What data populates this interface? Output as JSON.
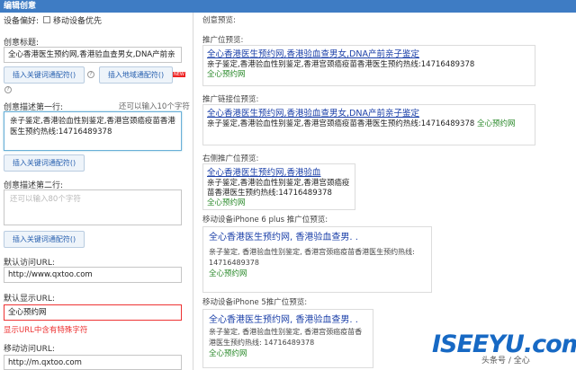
{
  "window": {
    "title": "编辑创意"
  },
  "form": {
    "device_pref_label": "设备偏好:",
    "device_pref_option": "移动设备优先",
    "title_label": "创意标题:",
    "title_value": "全心香港医生预约网,香港验血查男女,DNA产前亲",
    "insert_keyword_btn": "插入关键词通配符()",
    "insert_region_btn": "插入地域通配符()",
    "new_tag": "NEW",
    "desc1_label": "创意描述第一行:",
    "desc1_counter": "还可以输入10个字符",
    "desc1_value": "亲子鉴定,香港验血性别鉴定,香港宫颈癌疫苗香港医生预约热线:14716489378",
    "desc1_btn": "插入关键词通配符()",
    "desc2_label": "创意描述第二行:",
    "desc2_placeholder": "还可以输入80个字符",
    "desc2_btn": "插入关键词通配符()",
    "visit_url_label": "默认访问URL:",
    "visit_url_value": "http://www.qxtoo.com",
    "display_url_label": "默认显示URL:",
    "display_url_value": "全心预约网",
    "display_url_error": "显示URL中含有特殊字符",
    "mobile_url_label": "移动访问URL:",
    "mobile_url_value": "http://m.qxtoo.com"
  },
  "preview": {
    "heading": "创意预览:",
    "sections": [
      {
        "label": "推广位预览:",
        "title": "全心香港医生预约网,香港验血查男女,DNA产前亲子鉴定",
        "desc": "亲子鉴定,香港验血性别鉴定,香港宫颈癌疫苗香港医生预约热线:14716489378",
        "url": "全心预约网"
      },
      {
        "label": "推广链接位预览:",
        "title": "全心香港医生预约网,香港验血查男女,DNA产前亲子鉴定",
        "desc": "亲子鉴定,香港验血性别鉴定,香港宫颈癌疫苗香港医生预约热线:14716489378",
        "url": "全心预约网"
      },
      {
        "label": "右侧推广位预览:",
        "title": "全心香港医生预约网,香港验血",
        "desc": "亲子鉴定,香港验血性别鉴定,香港宫颈癌疫苗香港医生预约热线:14716489378",
        "url": "全心预约网"
      },
      {
        "label": "移动设备iPhone 6 plus 推广位预览:",
        "title": "全心香港医生预约网, 香港验血查男. .",
        "desc": "亲子鉴定, 香港验血性别鉴定, 香港宫颈癌疫苗香港医生预约热线: 14716489378",
        "url": "全心预约网"
      },
      {
        "label": "移动设备iPhone 5推广位预览:",
        "title": "全心香港医生预约网, 香港验血查男. .",
        "desc": "亲子鉴定, 香港验血性别鉴定, 香港宫颈癌疫苗香港医生预约热线: 14716489378",
        "url": "全心预约网"
      }
    ]
  },
  "watermark": {
    "brand": "ISEEYU.com",
    "sub": "头条号 / 全心"
  }
}
